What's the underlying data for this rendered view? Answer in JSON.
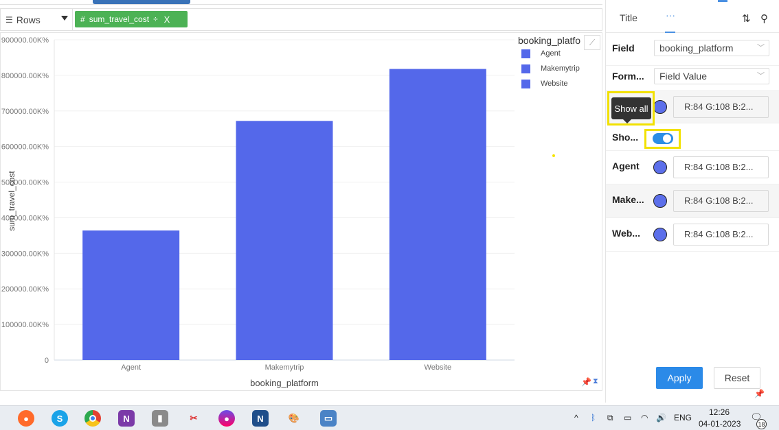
{
  "rows_shelf": {
    "label": "Rows",
    "pill_label": "sum_travel_cost",
    "pill_hash": "#",
    "pill_divide": "÷",
    "pill_close": "X"
  },
  "chart_data": {
    "type": "bar",
    "categories": [
      "Agent",
      "Makemytrip",
      "Website"
    ],
    "values": [
      364000,
      672000,
      818000
    ],
    "color": "#5468ea",
    "xlabel": "booking_platform",
    "ylabel": "sum_travel_cost",
    "ylim": [
      0,
      900000
    ],
    "yticks": [
      "0",
      "100000.00K%",
      "200000.00K%",
      "300000.00K%",
      "400000.00K%",
      "500000.00K%",
      "600000.00K%",
      "700000.00K%",
      "800000.00K%",
      "900000.00K%"
    ],
    "legend_title": "booking_platfo",
    "legend_position": "top-right",
    "grid": true
  },
  "panel": {
    "tab_title": "Title",
    "tab_more": "···",
    "field_label": "Field",
    "field_value": "booking_platform",
    "format_label": "Form...",
    "format_value": "Field Value",
    "tooltip": "Show all",
    "show_label": "Sho...",
    "show_toggle_on": true,
    "default_color": "R:84 G:108 B:2...",
    "series_rows": [
      {
        "label": "Agent",
        "color": "R:84 G:108 B:2..."
      },
      {
        "label": "Make...",
        "color": "R:84 G:108 B:2..."
      },
      {
        "label": "Web...",
        "color": "R:84 G:108 B:2..."
      }
    ],
    "apply_label": "Apply",
    "reset_label": "Reset"
  },
  "taskbar": {
    "lang": "ENG",
    "time": "12:26",
    "date": "04-01-2023",
    "notifications": "18",
    "apps": [
      "firefox-icon",
      "skype-icon",
      "chrome-icon",
      "onenote-icon",
      "recorder-icon",
      "snipping-icon",
      "firefox-dev-icon",
      "notepad-icon",
      "paint-icon",
      "window-icon"
    ]
  },
  "colors": {
    "bar": "#5468ea",
    "accent": "#2b8ae8",
    "pill": "#4cb255",
    "highlight": "#f2e100"
  }
}
